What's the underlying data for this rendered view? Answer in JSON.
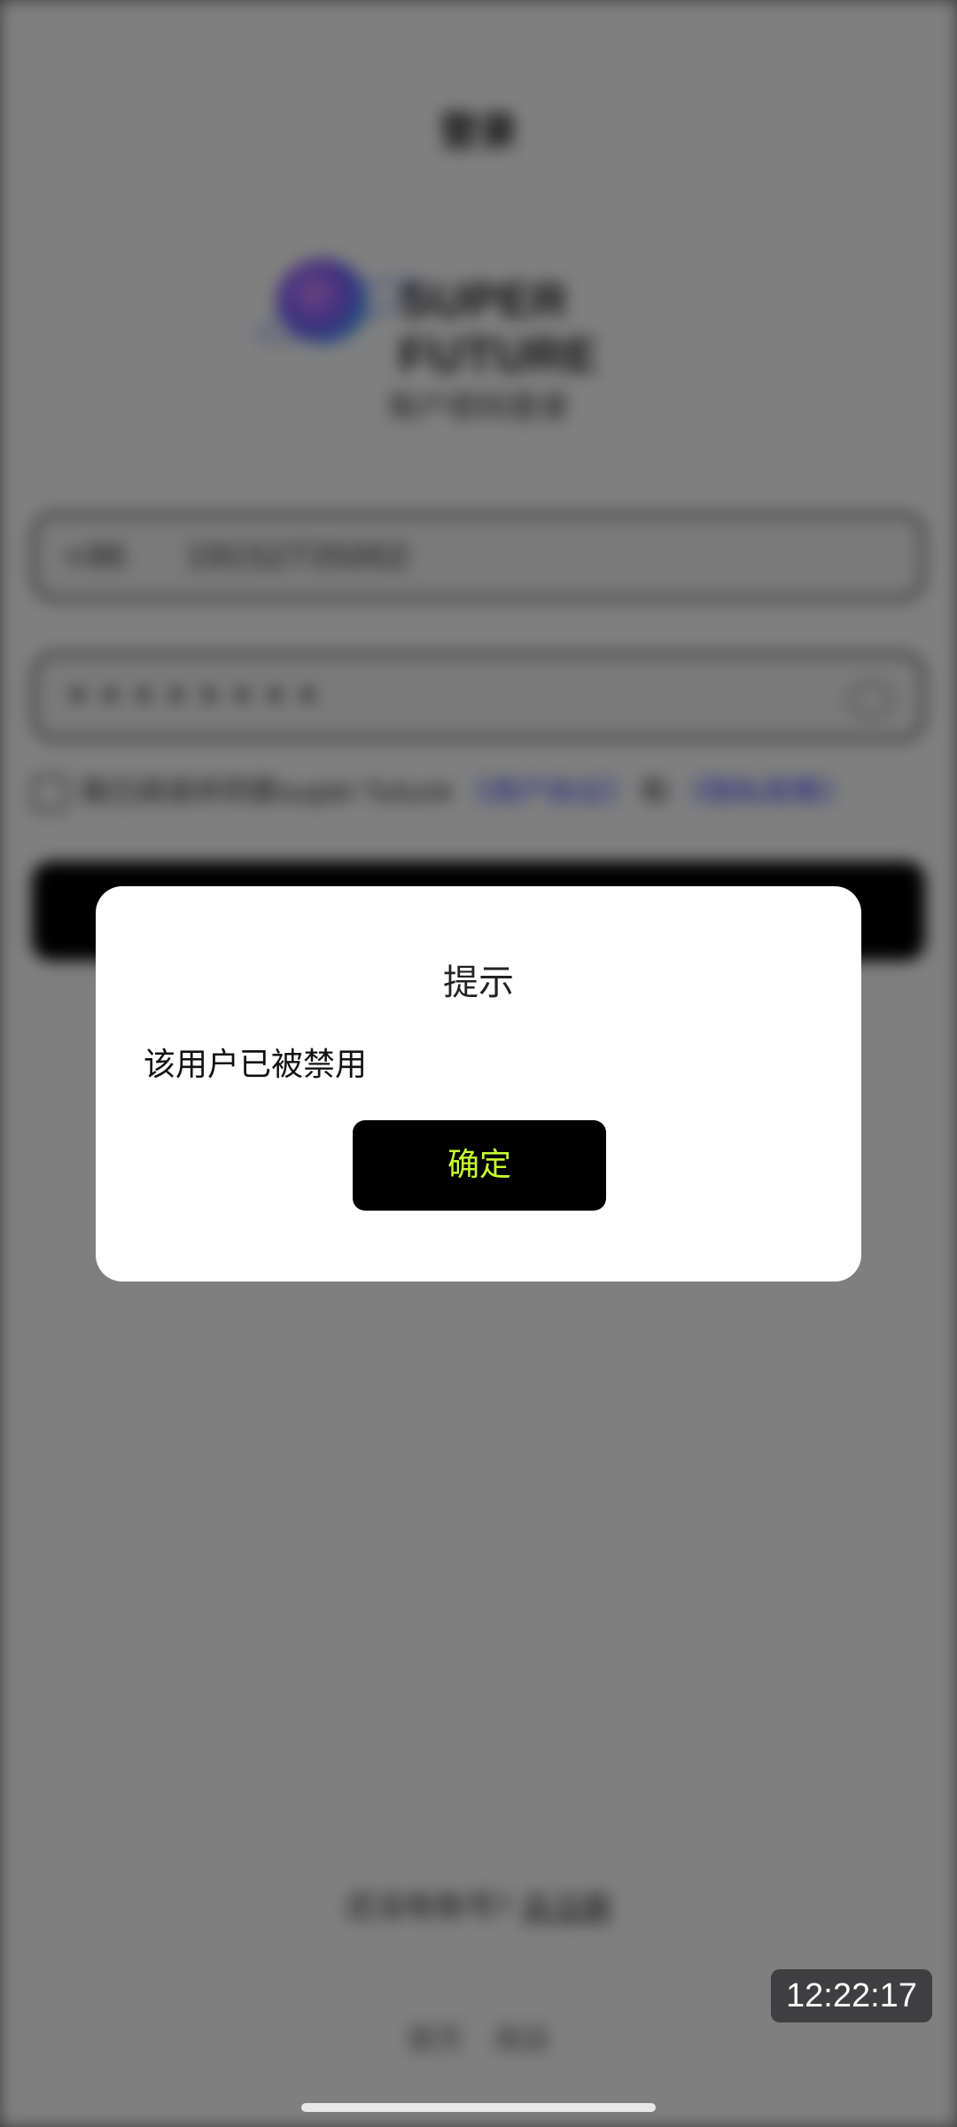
{
  "background_page": {
    "title": "登录",
    "logo_text": "SUPER FUTURE",
    "subtitle": "账户密码登录",
    "phone": {
      "country_code": "+86",
      "value": "19152735002"
    },
    "password": {
      "masked_value": "••••••••"
    },
    "agreement": {
      "prefix": "我已阅读并同意super future",
      "user_agreement": "《用户协议》",
      "conjunction": "和",
      "privacy_policy": "《隐私政策》"
    },
    "register": {
      "prefix": "还没有账号?",
      "link": "去注册"
    },
    "footer_links": [
      "首页",
      "商店"
    ]
  },
  "dialog": {
    "title": "提示",
    "message": "该用户已被禁用",
    "confirm_label": "确定"
  },
  "timestamp": "12:22:17",
  "colors": {
    "overlay": "#000000",
    "dialog_background": "#ffffff",
    "button_background": "#000000",
    "button_text": "#c7ff2e",
    "link": "#2b3cff"
  }
}
